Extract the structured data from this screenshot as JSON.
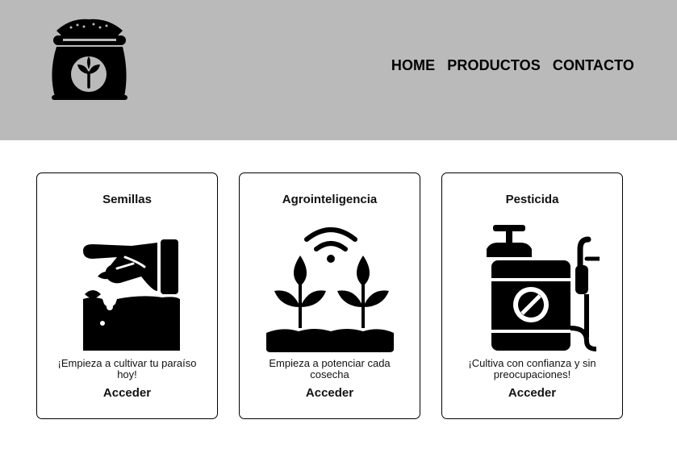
{
  "header": {
    "logo_icon": "seed-bag-icon",
    "background": "#bababa",
    "nav": [
      {
        "label": "HOME"
      },
      {
        "label": "PRODUCTOS"
      },
      {
        "label": "CONTACTO"
      }
    ]
  },
  "cards": [
    {
      "title": "Semillas",
      "icon": "hand-planting-seed-icon",
      "description": "¡Empieza a cultivar tu paraíso hoy!",
      "link": "Acceder"
    },
    {
      "title": "Agrointeligencia",
      "icon": "smart-farming-wifi-plants-icon",
      "description": "Empieza a potenciar cada cosecha",
      "link": "Acceder"
    },
    {
      "title": "Pesticida",
      "icon": "pesticide-sprayer-icon",
      "description": "¡Cultiva con confianza y sin preocupaciones!",
      "link": "Acceder"
    }
  ]
}
